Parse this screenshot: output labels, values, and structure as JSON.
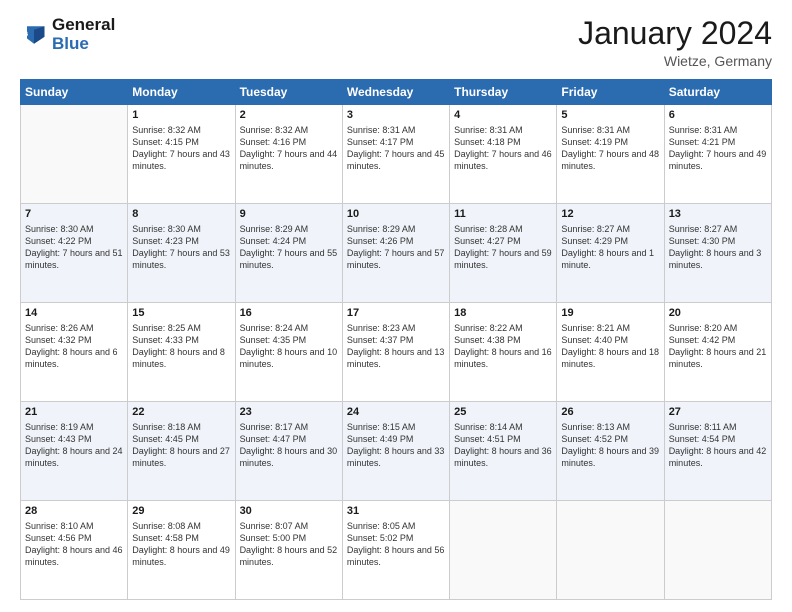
{
  "header": {
    "logo_line1": "General",
    "logo_line2": "Blue",
    "month": "January 2024",
    "location": "Wietze, Germany"
  },
  "weekdays": [
    "Sunday",
    "Monday",
    "Tuesday",
    "Wednesday",
    "Thursday",
    "Friday",
    "Saturday"
  ],
  "weeks": [
    [
      {
        "day": "",
        "sunrise": "",
        "sunset": "",
        "daylight": ""
      },
      {
        "day": "1",
        "sunrise": "Sunrise: 8:32 AM",
        "sunset": "Sunset: 4:15 PM",
        "daylight": "Daylight: 7 hours and 43 minutes."
      },
      {
        "day": "2",
        "sunrise": "Sunrise: 8:32 AM",
        "sunset": "Sunset: 4:16 PM",
        "daylight": "Daylight: 7 hours and 44 minutes."
      },
      {
        "day": "3",
        "sunrise": "Sunrise: 8:31 AM",
        "sunset": "Sunset: 4:17 PM",
        "daylight": "Daylight: 7 hours and 45 minutes."
      },
      {
        "day": "4",
        "sunrise": "Sunrise: 8:31 AM",
        "sunset": "Sunset: 4:18 PM",
        "daylight": "Daylight: 7 hours and 46 minutes."
      },
      {
        "day": "5",
        "sunrise": "Sunrise: 8:31 AM",
        "sunset": "Sunset: 4:19 PM",
        "daylight": "Daylight: 7 hours and 48 minutes."
      },
      {
        "day": "6",
        "sunrise": "Sunrise: 8:31 AM",
        "sunset": "Sunset: 4:21 PM",
        "daylight": "Daylight: 7 hours and 49 minutes."
      }
    ],
    [
      {
        "day": "7",
        "sunrise": "Sunrise: 8:30 AM",
        "sunset": "Sunset: 4:22 PM",
        "daylight": "Daylight: 7 hours and 51 minutes."
      },
      {
        "day": "8",
        "sunrise": "Sunrise: 8:30 AM",
        "sunset": "Sunset: 4:23 PM",
        "daylight": "Daylight: 7 hours and 53 minutes."
      },
      {
        "day": "9",
        "sunrise": "Sunrise: 8:29 AM",
        "sunset": "Sunset: 4:24 PM",
        "daylight": "Daylight: 7 hours and 55 minutes."
      },
      {
        "day": "10",
        "sunrise": "Sunrise: 8:29 AM",
        "sunset": "Sunset: 4:26 PM",
        "daylight": "Daylight: 7 hours and 57 minutes."
      },
      {
        "day": "11",
        "sunrise": "Sunrise: 8:28 AM",
        "sunset": "Sunset: 4:27 PM",
        "daylight": "Daylight: 7 hours and 59 minutes."
      },
      {
        "day": "12",
        "sunrise": "Sunrise: 8:27 AM",
        "sunset": "Sunset: 4:29 PM",
        "daylight": "Daylight: 8 hours and 1 minute."
      },
      {
        "day": "13",
        "sunrise": "Sunrise: 8:27 AM",
        "sunset": "Sunset: 4:30 PM",
        "daylight": "Daylight: 8 hours and 3 minutes."
      }
    ],
    [
      {
        "day": "14",
        "sunrise": "Sunrise: 8:26 AM",
        "sunset": "Sunset: 4:32 PM",
        "daylight": "Daylight: 8 hours and 6 minutes."
      },
      {
        "day": "15",
        "sunrise": "Sunrise: 8:25 AM",
        "sunset": "Sunset: 4:33 PM",
        "daylight": "Daylight: 8 hours and 8 minutes."
      },
      {
        "day": "16",
        "sunrise": "Sunrise: 8:24 AM",
        "sunset": "Sunset: 4:35 PM",
        "daylight": "Daylight: 8 hours and 10 minutes."
      },
      {
        "day": "17",
        "sunrise": "Sunrise: 8:23 AM",
        "sunset": "Sunset: 4:37 PM",
        "daylight": "Daylight: 8 hours and 13 minutes."
      },
      {
        "day": "18",
        "sunrise": "Sunrise: 8:22 AM",
        "sunset": "Sunset: 4:38 PM",
        "daylight": "Daylight: 8 hours and 16 minutes."
      },
      {
        "day": "19",
        "sunrise": "Sunrise: 8:21 AM",
        "sunset": "Sunset: 4:40 PM",
        "daylight": "Daylight: 8 hours and 18 minutes."
      },
      {
        "day": "20",
        "sunrise": "Sunrise: 8:20 AM",
        "sunset": "Sunset: 4:42 PM",
        "daylight": "Daylight: 8 hours and 21 minutes."
      }
    ],
    [
      {
        "day": "21",
        "sunrise": "Sunrise: 8:19 AM",
        "sunset": "Sunset: 4:43 PM",
        "daylight": "Daylight: 8 hours and 24 minutes."
      },
      {
        "day": "22",
        "sunrise": "Sunrise: 8:18 AM",
        "sunset": "Sunset: 4:45 PM",
        "daylight": "Daylight: 8 hours and 27 minutes."
      },
      {
        "day": "23",
        "sunrise": "Sunrise: 8:17 AM",
        "sunset": "Sunset: 4:47 PM",
        "daylight": "Daylight: 8 hours and 30 minutes."
      },
      {
        "day": "24",
        "sunrise": "Sunrise: 8:15 AM",
        "sunset": "Sunset: 4:49 PM",
        "daylight": "Daylight: 8 hours and 33 minutes."
      },
      {
        "day": "25",
        "sunrise": "Sunrise: 8:14 AM",
        "sunset": "Sunset: 4:51 PM",
        "daylight": "Daylight: 8 hours and 36 minutes."
      },
      {
        "day": "26",
        "sunrise": "Sunrise: 8:13 AM",
        "sunset": "Sunset: 4:52 PM",
        "daylight": "Daylight: 8 hours and 39 minutes."
      },
      {
        "day": "27",
        "sunrise": "Sunrise: 8:11 AM",
        "sunset": "Sunset: 4:54 PM",
        "daylight": "Daylight: 8 hours and 42 minutes."
      }
    ],
    [
      {
        "day": "28",
        "sunrise": "Sunrise: 8:10 AM",
        "sunset": "Sunset: 4:56 PM",
        "daylight": "Daylight: 8 hours and 46 minutes."
      },
      {
        "day": "29",
        "sunrise": "Sunrise: 8:08 AM",
        "sunset": "Sunset: 4:58 PM",
        "daylight": "Daylight: 8 hours and 49 minutes."
      },
      {
        "day": "30",
        "sunrise": "Sunrise: 8:07 AM",
        "sunset": "Sunset: 5:00 PM",
        "daylight": "Daylight: 8 hours and 52 minutes."
      },
      {
        "day": "31",
        "sunrise": "Sunrise: 8:05 AM",
        "sunset": "Sunset: 5:02 PM",
        "daylight": "Daylight: 8 hours and 56 minutes."
      },
      {
        "day": "",
        "sunrise": "",
        "sunset": "",
        "daylight": ""
      },
      {
        "day": "",
        "sunrise": "",
        "sunset": "",
        "daylight": ""
      },
      {
        "day": "",
        "sunrise": "",
        "sunset": "",
        "daylight": ""
      }
    ]
  ]
}
